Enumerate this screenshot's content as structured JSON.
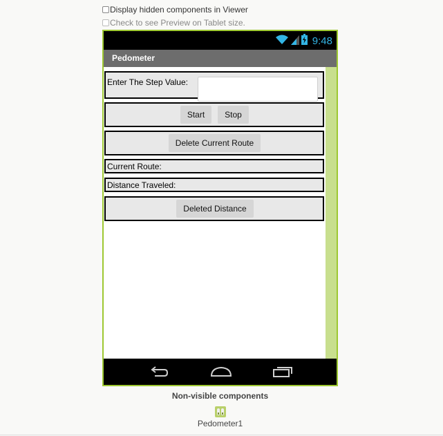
{
  "viewer_options": {
    "hidden_components_label": "Display hidden components in Viewer",
    "tablet_preview_label": "Check to see Preview on Tablet size."
  },
  "status_bar": {
    "time": "9:48",
    "icons": [
      "wifi-icon",
      "signal-icon",
      "battery-icon"
    ]
  },
  "screen": {
    "title": "Pedometer",
    "step_value_label": "Enter The Step Value:",
    "step_value_input": "",
    "start_label": "Start",
    "stop_label": "Stop",
    "delete_route_label": "Delete Current Route",
    "current_route_label": "Current Route:",
    "distance_label": "Distance Traveled:",
    "deleted_distance_label": "Deleted Distance"
  },
  "nav_bar": {
    "icons": [
      "back-icon",
      "home-icon",
      "recents-icon"
    ]
  },
  "non_visible": {
    "title": "Non-visible components",
    "components": [
      {
        "name": "Pedometer1",
        "icon": "pedometer-icon"
      }
    ]
  },
  "colors": {
    "accent_green": "#9dc830",
    "scroll_green": "#c8df8e",
    "time_blue": "#33b5e5",
    "titlebar_gray": "#6d6d6d"
  }
}
